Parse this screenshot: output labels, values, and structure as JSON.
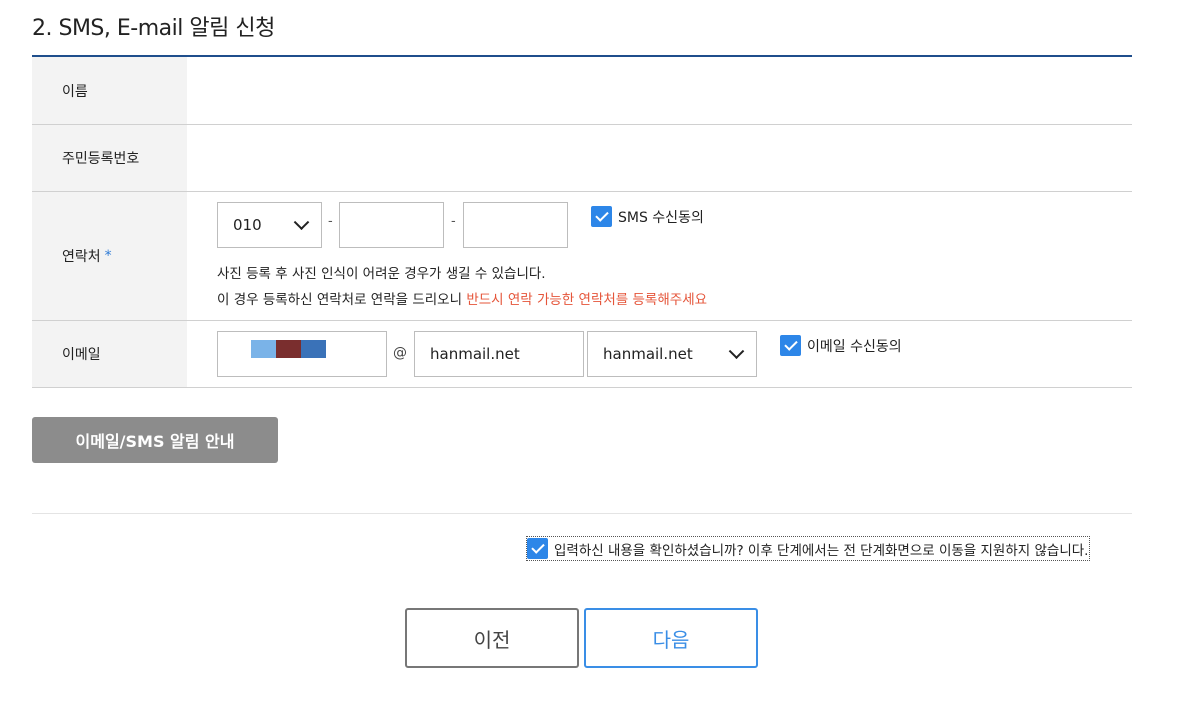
{
  "section": {
    "title": "2. SMS, E-mail 알림 신청"
  },
  "form": {
    "name": {
      "label": "이름",
      "value": ""
    },
    "resident_id": {
      "label": "주민등록번호",
      "value": ""
    },
    "phone": {
      "label": "연락처",
      "required_mark": "*",
      "prefix_selected": "010",
      "separator": "-",
      "middle": "",
      "last": "",
      "sms_consent_label": "SMS 수신동의",
      "sms_consent_checked": true,
      "notice_line1": "사진 등록 후 사진 인식이 어려운 경우가 생길 수 있습니다.",
      "notice_line2": "이 경우 등록하신 연락처로 연락을 드리오니 ",
      "notice_warning": "반드시 연락 가능한 연락처를 등록해주세요"
    },
    "email": {
      "label": "이메일",
      "at": "@",
      "domain_value": "hanmail.net",
      "domain_selected": "hanmail.net",
      "email_consent_label": "이메일 수신동의",
      "email_consent_checked": true,
      "masked_colors": [
        "#7ab3e8",
        "#7a2e2e",
        "#3a72b8"
      ]
    }
  },
  "buttons": {
    "guide": "이메일/SMS 알림 안내",
    "prev": "이전",
    "next": "다음"
  },
  "confirm": {
    "label": "입력하신 내용을 확인하셨습니까? 이후 단계에서는 전 단계화면으로 이동을 지원하지 않습니다.",
    "checked": true
  },
  "colors": {
    "accent": "#2d86e8",
    "border_top": "#1f4e8c",
    "warning": "#e5553a"
  }
}
